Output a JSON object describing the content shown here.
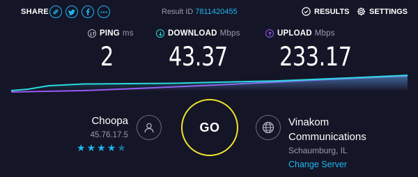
{
  "share": {
    "label": "SHARE",
    "icons": [
      "link-icon",
      "twitter-icon",
      "facebook-icon",
      "more-icon"
    ]
  },
  "result": {
    "label": "Result ID",
    "id": "7811420455"
  },
  "nav": {
    "results": "RESULTS",
    "settings": "SETTINGS"
  },
  "metrics": {
    "ping": {
      "label": "PING",
      "unit": "ms",
      "value": "2"
    },
    "download": {
      "label": "DOWNLOAD",
      "unit": "Mbps",
      "value": "43.37"
    },
    "upload": {
      "label": "UPLOAD",
      "unit": "Mbps",
      "value": "233.17"
    }
  },
  "host": {
    "name": "Choopa",
    "ip": "45.76.17.5",
    "rating": 4,
    "max_rating": 5
  },
  "go": {
    "label": "GO"
  },
  "server": {
    "name_line1": "Vinakom",
    "name_line2": "Communications",
    "location": "Schaumburg, IL",
    "change": "Change Server"
  },
  "colors": {
    "accent": "#1fb7f1",
    "download": "#2bd9e0",
    "upload": "#9b59f5",
    "go": "#f2e42b",
    "background": "#141526"
  }
}
